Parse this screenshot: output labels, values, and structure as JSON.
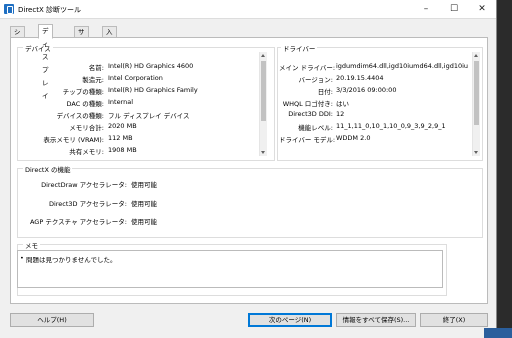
{
  "window": {
    "title": "DirectX 診断ツール"
  },
  "tabs": [
    "システム",
    "ディスプレイ",
    "サウンド",
    "入力"
  ],
  "device": {
    "group_title": "デバイス",
    "rows": [
      {
        "label": "名前:",
        "value": "Intel(R) HD Graphics 4600"
      },
      {
        "label": "製造元:",
        "value": "Intel Corporation"
      },
      {
        "label": "チップの種類:",
        "value": "Intel(R) HD Graphics Family"
      },
      {
        "label": "DAC の種類:",
        "value": "Internal"
      },
      {
        "label": "デバイスの種類:",
        "value": "フル ディスプレイ デバイス"
      },
      {
        "label": "メモリ合計:",
        "value": "2020 MB"
      },
      {
        "label": "表示メモリ (VRAM):",
        "value": "112 MB"
      },
      {
        "label": "共有メモリ:",
        "value": "1908 MB"
      }
    ]
  },
  "driver": {
    "group_title": "ドライバー",
    "rows": [
      {
        "label": "メイン ドライバー:",
        "value": "igdumdim64.dll,igd10iumd64.dll,igd10iu"
      },
      {
        "label": "バージョン:",
        "value": "20.19.15.4404"
      },
      {
        "label": "日付:",
        "value": "3/3/2016 09:00:00"
      },
      {
        "label": "WHQL ロゴ付き:",
        "value": "はい"
      },
      {
        "label": "Direct3D DDI:",
        "value": "12"
      },
      {
        "label": "機能レベル:",
        "value": "11_1,11_0,10_1,10_0,9_3,9_2,9_1"
      },
      {
        "label": "ドライバー モデル:",
        "value": "WDDM 2.0"
      }
    ]
  },
  "features": {
    "group_title": "DirectX の機能",
    "rows": [
      {
        "label": "DirectDraw アクセラレータ:",
        "value": "使用可能"
      },
      {
        "label": "Direct3D アクセラレータ:",
        "value": "使用可能"
      },
      {
        "label": "AGP テクスチャ アクセラレータ:",
        "value": "使用可能"
      }
    ]
  },
  "notes": {
    "group_title": "メモ",
    "items": [
      "問題は見つかりませんでした。"
    ]
  },
  "buttons": {
    "help": "ヘルプ(H)",
    "next_page": "次のページ(N)",
    "save_all": "情報をすべて保存(S)...",
    "exit": "終了(X)"
  }
}
